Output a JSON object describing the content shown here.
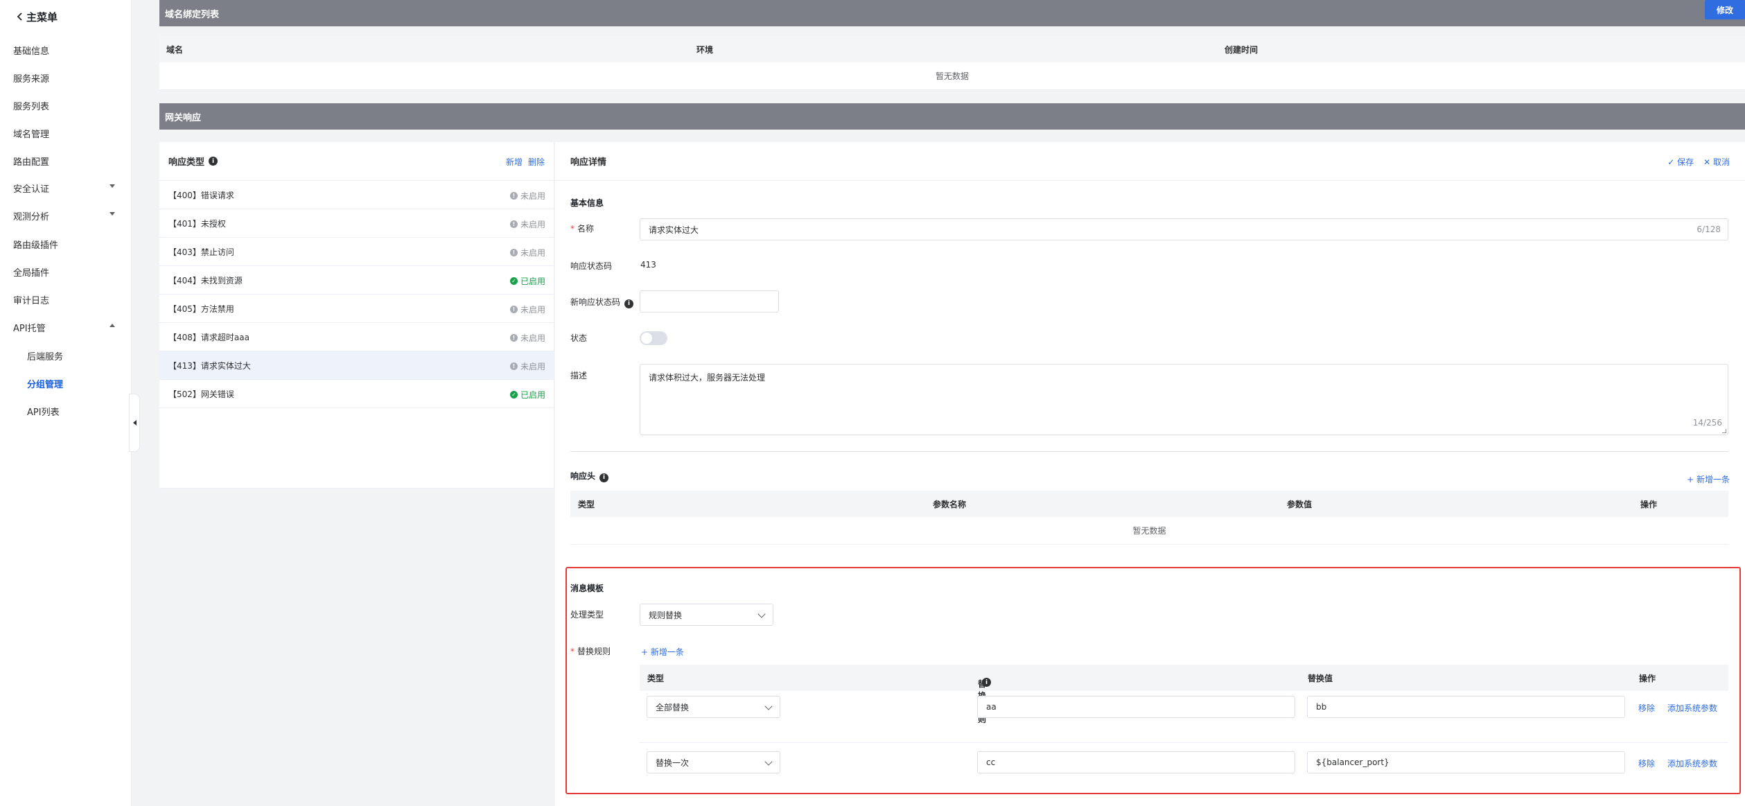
{
  "sidebar": {
    "back_title": "主菜单",
    "items": [
      {
        "label": "基础信息"
      },
      {
        "label": "服务来源"
      },
      {
        "label": "服务列表"
      },
      {
        "label": "域名管理"
      },
      {
        "label": "路由配置"
      },
      {
        "label": "安全认证"
      },
      {
        "label": "观测分析"
      },
      {
        "label": "路由级插件"
      },
      {
        "label": "全局插件"
      },
      {
        "label": "审计日志"
      },
      {
        "label": "API托管"
      },
      {
        "label": "后端服务"
      },
      {
        "label": "分组管理"
      },
      {
        "label": "API列表"
      }
    ]
  },
  "domain_section": {
    "title": "域名绑定列表",
    "edit_label": "修改",
    "columns": [
      "域名",
      "环境",
      "创建时间"
    ],
    "empty_text": "暂无数据"
  },
  "gateway_section": {
    "title": "网关响应"
  },
  "response_types": {
    "title": "响应类型",
    "add_label": "新增",
    "delete_label": "删除",
    "rows": [
      {
        "label": "【400】错误请求",
        "status": "未启用"
      },
      {
        "label": "【401】未授权",
        "status": "未启用"
      },
      {
        "label": "【403】禁止访问",
        "status": "未启用"
      },
      {
        "label": "【404】未找到资源",
        "status": "已启用"
      },
      {
        "label": "【405】方法禁用",
        "status": "未启用"
      },
      {
        "label": "【408】请求超时aaa",
        "status": "未启用"
      },
      {
        "label": "【413】请求实体过大",
        "status": "未启用"
      },
      {
        "label": "【502】网关错误",
        "status": "已启用"
      }
    ]
  },
  "detail": {
    "title": "响应详情",
    "save_label": "✓ 保存",
    "cancel_label": "✕ 取消",
    "basic_info_title": "基本信息",
    "name_label": "名称",
    "name_value": "请求实体过大",
    "name_count": "6/128",
    "status_code_label": "响应状态码",
    "status_code_value": "413",
    "new_status_code_label": "新响应状态码",
    "new_status_code_value": "",
    "state_label": "状态",
    "state_on": false,
    "desc_label": "描述",
    "desc_value": "请求体积过大，服务器无法处理",
    "desc_count": "14/256",
    "headers_title": "响应头",
    "headers_add": "+ 新增一条",
    "headers_columns": [
      "类型",
      "参数名称",
      "参数值",
      "操作"
    ],
    "headers_empty": "暂无数据"
  },
  "message_template": {
    "title": "消息模板",
    "process_type_label": "处理类型",
    "process_type_value": "规则替换",
    "rules_label": "替换规则",
    "rules_add": "+ 新增一条",
    "columns": [
      "类型",
      "替换规则",
      "替换值",
      "操作"
    ],
    "rows": [
      {
        "type": "全部替换",
        "rule": "aa",
        "value": "bb",
        "remove": "移除",
        "add_param": "添加系统参数"
      },
      {
        "type": "替换一次",
        "rule": "cc",
        "value": "${balancer_port}",
        "remove": "移除",
        "add_param": "添加系统参数"
      }
    ]
  },
  "colors": {
    "accent": "#2f6de0",
    "highlight_border": "#e53935",
    "enabled": "#1aa04a"
  }
}
